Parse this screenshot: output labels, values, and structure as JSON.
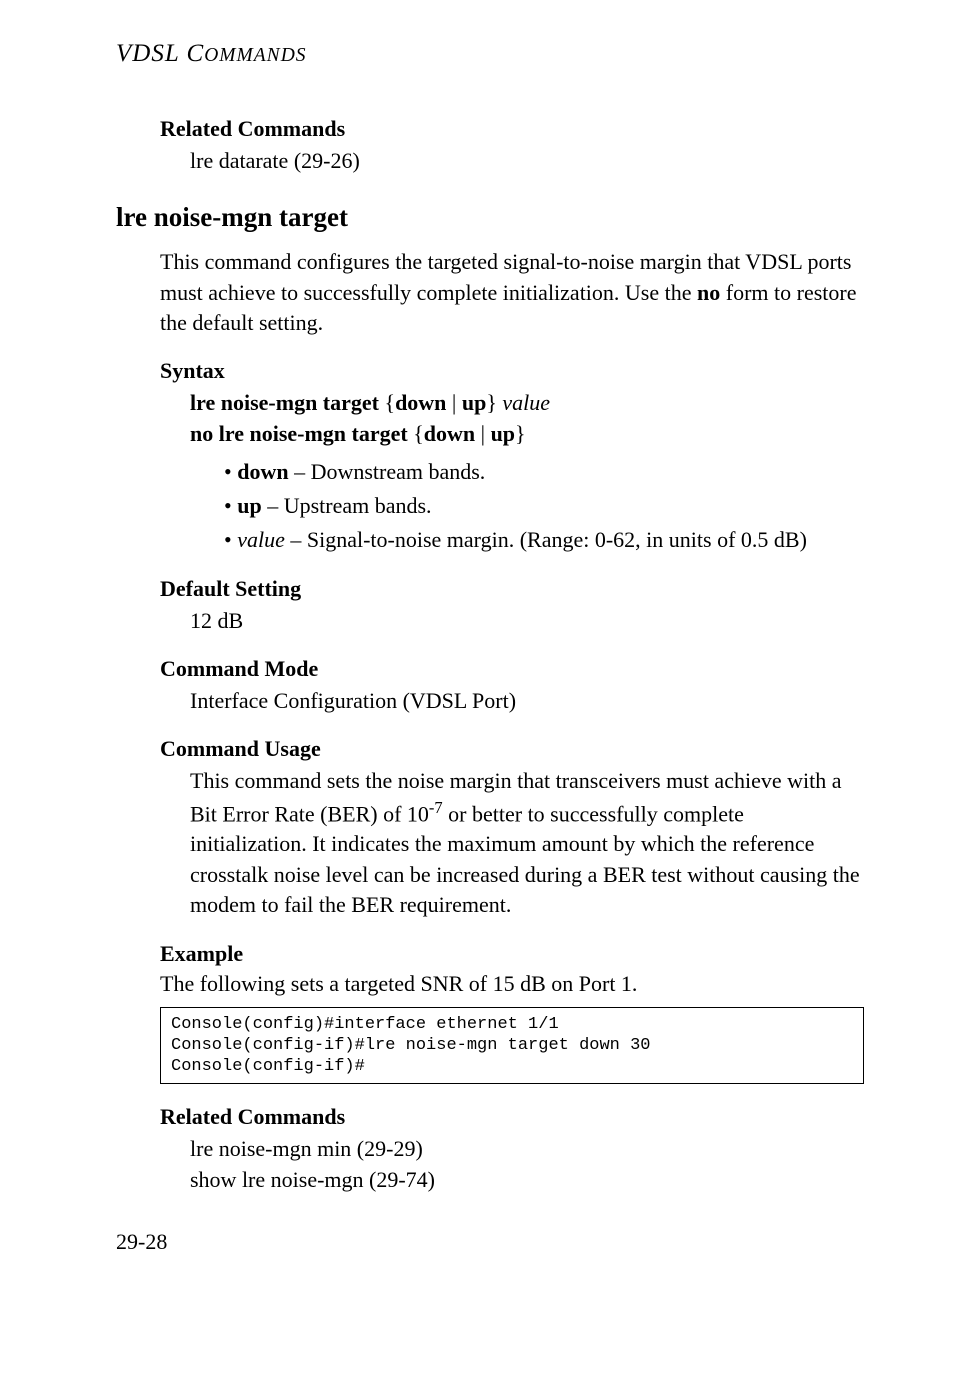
{
  "running_header": "VDSL COMMANDS",
  "sections": {
    "related_top": {
      "heading": "Related Commands",
      "line": "lre datarate (29-26)"
    },
    "command_heading": "lre noise-mgn target",
    "intro_pre": "This command configures the targeted signal-to-noise margin that VDSL ports must achieve to successfully complete initialization. Use the ",
    "intro_bold": "no",
    "intro_post": " form to restore the default setting.",
    "syntax": {
      "heading": "Syntax",
      "line1_b1": "lre noise-mgn target",
      "line1_plain1": " {",
      "line1_b2": "down",
      "line1_plain2": " | ",
      "line1_b3": "up",
      "line1_plain3": "} ",
      "line1_i": "value",
      "line2_b1": "no lre noise-mgn target",
      "line2_plain1": " {",
      "line2_b2": "down",
      "line2_plain2": " | ",
      "line2_b3": "up",
      "line2_plain3": "}",
      "bullets": {
        "b1_bold": "down",
        "b1_rest": " – Downstream bands.",
        "b2_bold": "up",
        "b2_rest": " – Upstream bands.",
        "b3_ital": "value",
        "b3_rest": " – Signal-to-noise margin. (Range: 0-62, in units of 0.5 dB)"
      }
    },
    "default": {
      "heading": "Default Setting",
      "value": "12 dB"
    },
    "mode": {
      "heading": "Command Mode",
      "value": "Interface Configuration (VDSL Port)"
    },
    "usage": {
      "heading": "Command Usage",
      "pre": "This command sets the noise margin that transceivers must achieve with a Bit Error Rate (BER) of 10",
      "sup": "-7",
      "post": " or better to successfully complete initialization. It indicates the maximum amount by which the reference crosstalk noise level can be increased during a BER test without causing the modem to fail the BER requirement."
    },
    "example": {
      "heading": "Example",
      "intro": "The following sets a targeted SNR of 15 dB on Port 1.",
      "code": "Console(config)#interface ethernet 1/1\nConsole(config-if)#lre noise-mgn target down 30\nConsole(config-if)#"
    },
    "related_bottom": {
      "heading": "Related Commands",
      "line1": "lre noise-mgn min (29-29)",
      "line2": "show lre noise-mgn (29-74)"
    }
  },
  "page_number": "29-28"
}
